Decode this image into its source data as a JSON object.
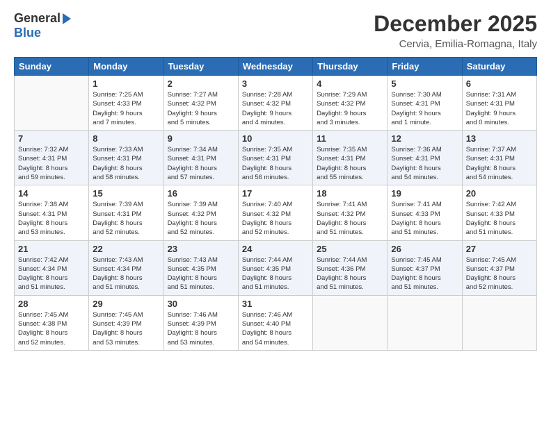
{
  "logo": {
    "general": "General",
    "blue": "Blue"
  },
  "header": {
    "month": "December 2025",
    "location": "Cervia, Emilia-Romagna, Italy"
  },
  "weekdays": [
    "Sunday",
    "Monday",
    "Tuesday",
    "Wednesday",
    "Thursday",
    "Friday",
    "Saturday"
  ],
  "weeks": [
    [
      {
        "day": "",
        "info": ""
      },
      {
        "day": "1",
        "info": "Sunrise: 7:25 AM\nSunset: 4:33 PM\nDaylight: 9 hours\nand 7 minutes."
      },
      {
        "day": "2",
        "info": "Sunrise: 7:27 AM\nSunset: 4:32 PM\nDaylight: 9 hours\nand 5 minutes."
      },
      {
        "day": "3",
        "info": "Sunrise: 7:28 AM\nSunset: 4:32 PM\nDaylight: 9 hours\nand 4 minutes."
      },
      {
        "day": "4",
        "info": "Sunrise: 7:29 AM\nSunset: 4:32 PM\nDaylight: 9 hours\nand 3 minutes."
      },
      {
        "day": "5",
        "info": "Sunrise: 7:30 AM\nSunset: 4:31 PM\nDaylight: 9 hours\nand 1 minute."
      },
      {
        "day": "6",
        "info": "Sunrise: 7:31 AM\nSunset: 4:31 PM\nDaylight: 9 hours\nand 0 minutes."
      }
    ],
    [
      {
        "day": "7",
        "info": "Sunrise: 7:32 AM\nSunset: 4:31 PM\nDaylight: 8 hours\nand 59 minutes."
      },
      {
        "day": "8",
        "info": "Sunrise: 7:33 AM\nSunset: 4:31 PM\nDaylight: 8 hours\nand 58 minutes."
      },
      {
        "day": "9",
        "info": "Sunrise: 7:34 AM\nSunset: 4:31 PM\nDaylight: 8 hours\nand 57 minutes."
      },
      {
        "day": "10",
        "info": "Sunrise: 7:35 AM\nSunset: 4:31 PM\nDaylight: 8 hours\nand 56 minutes."
      },
      {
        "day": "11",
        "info": "Sunrise: 7:35 AM\nSunset: 4:31 PM\nDaylight: 8 hours\nand 55 minutes."
      },
      {
        "day": "12",
        "info": "Sunrise: 7:36 AM\nSunset: 4:31 PM\nDaylight: 8 hours\nand 54 minutes."
      },
      {
        "day": "13",
        "info": "Sunrise: 7:37 AM\nSunset: 4:31 PM\nDaylight: 8 hours\nand 54 minutes."
      }
    ],
    [
      {
        "day": "14",
        "info": "Sunrise: 7:38 AM\nSunset: 4:31 PM\nDaylight: 8 hours\nand 53 minutes."
      },
      {
        "day": "15",
        "info": "Sunrise: 7:39 AM\nSunset: 4:31 PM\nDaylight: 8 hours\nand 52 minutes."
      },
      {
        "day": "16",
        "info": "Sunrise: 7:39 AM\nSunset: 4:32 PM\nDaylight: 8 hours\nand 52 minutes."
      },
      {
        "day": "17",
        "info": "Sunrise: 7:40 AM\nSunset: 4:32 PM\nDaylight: 8 hours\nand 52 minutes."
      },
      {
        "day": "18",
        "info": "Sunrise: 7:41 AM\nSunset: 4:32 PM\nDaylight: 8 hours\nand 51 minutes."
      },
      {
        "day": "19",
        "info": "Sunrise: 7:41 AM\nSunset: 4:33 PM\nDaylight: 8 hours\nand 51 minutes."
      },
      {
        "day": "20",
        "info": "Sunrise: 7:42 AM\nSunset: 4:33 PM\nDaylight: 8 hours\nand 51 minutes."
      }
    ],
    [
      {
        "day": "21",
        "info": "Sunrise: 7:42 AM\nSunset: 4:34 PM\nDaylight: 8 hours\nand 51 minutes."
      },
      {
        "day": "22",
        "info": "Sunrise: 7:43 AM\nSunset: 4:34 PM\nDaylight: 8 hours\nand 51 minutes."
      },
      {
        "day": "23",
        "info": "Sunrise: 7:43 AM\nSunset: 4:35 PM\nDaylight: 8 hours\nand 51 minutes."
      },
      {
        "day": "24",
        "info": "Sunrise: 7:44 AM\nSunset: 4:35 PM\nDaylight: 8 hours\nand 51 minutes."
      },
      {
        "day": "25",
        "info": "Sunrise: 7:44 AM\nSunset: 4:36 PM\nDaylight: 8 hours\nand 51 minutes."
      },
      {
        "day": "26",
        "info": "Sunrise: 7:45 AM\nSunset: 4:37 PM\nDaylight: 8 hours\nand 51 minutes."
      },
      {
        "day": "27",
        "info": "Sunrise: 7:45 AM\nSunset: 4:37 PM\nDaylight: 8 hours\nand 52 minutes."
      }
    ],
    [
      {
        "day": "28",
        "info": "Sunrise: 7:45 AM\nSunset: 4:38 PM\nDaylight: 8 hours\nand 52 minutes."
      },
      {
        "day": "29",
        "info": "Sunrise: 7:45 AM\nSunset: 4:39 PM\nDaylight: 8 hours\nand 53 minutes."
      },
      {
        "day": "30",
        "info": "Sunrise: 7:46 AM\nSunset: 4:39 PM\nDaylight: 8 hours\nand 53 minutes."
      },
      {
        "day": "31",
        "info": "Sunrise: 7:46 AM\nSunset: 4:40 PM\nDaylight: 8 hours\nand 54 minutes."
      },
      {
        "day": "",
        "info": ""
      },
      {
        "day": "",
        "info": ""
      },
      {
        "day": "",
        "info": ""
      }
    ]
  ]
}
